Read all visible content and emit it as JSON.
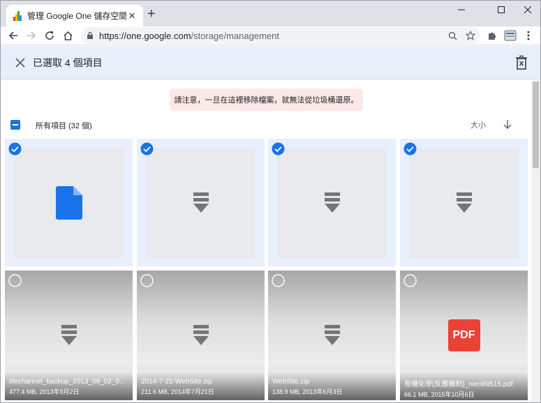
{
  "tab": {
    "title": "管理 Google One 儲存空間",
    "close": "✕",
    "new": "+"
  },
  "browser": {
    "url_host": "https://one.google.com",
    "url_path": "/storage/management"
  },
  "selection_bar": {
    "title": "已選取 4 個項目"
  },
  "warning": "請注意，一旦在這裡移除檔案，就無法從垃圾桶還原。",
  "list_header": {
    "all_items": "所有項目 (32 個)",
    "sort_label": "大小"
  },
  "colors": {
    "accent": "#1a73e8",
    "selected_bg": "#e8f0fe",
    "pdf_red": "#ea4335",
    "warning_bg": "#fce8e6"
  },
  "cards_row1": [
    {
      "type": "doc-icon",
      "selected": true
    },
    {
      "type": "archive-icon",
      "selected": true
    },
    {
      "type": "archive-icon",
      "selected": true
    },
    {
      "type": "archive-icon",
      "selected": true
    }
  ],
  "cards_row2": [
    {
      "name": "lifechannel_backup_2013_09_02_0...",
      "info": "477.4 MB, 2013年9月2日",
      "type": "archive-icon",
      "selected": false
    },
    {
      "name": "2014-7-21-WebSite.zip",
      "info": "211.6 MB, 2014年7月21日",
      "type": "archive-icon",
      "selected": false
    },
    {
      "name": "WebSite.zip",
      "info": "138.9 MB, 2013年6月3日",
      "type": "archive-icon",
      "selected": false
    },
    {
      "name": "有機化學(反應機制)_nien89515.pdf",
      "info": "66.1 MB, 2015年10月6日",
      "type": "pdf-icon",
      "pdf_label": "PDF",
      "selected": false
    }
  ]
}
